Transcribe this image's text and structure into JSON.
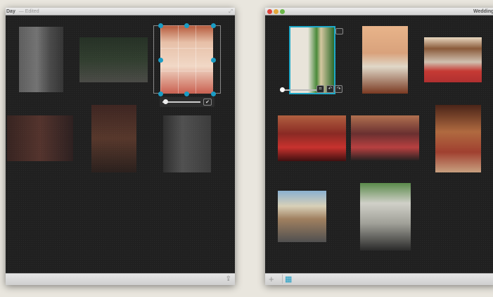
{
  "left_window": {
    "title": "Day",
    "edited": "— Edited",
    "photos": [
      "dress-hanging",
      "garden-path",
      "dress-back-crop",
      "reception-room",
      "church-interior",
      "couple-walking"
    ],
    "crop_grid_active": true
  },
  "right_window": {
    "title": "Wedding",
    "photos": [
      "marquee-rotated",
      "mirror-flowers",
      "tea-table",
      "guests-seated-1",
      "guests-seated-2",
      "church-aisle",
      "street-bus",
      "vintage-car"
    ]
  },
  "icons": {
    "share": "share-icon",
    "add": "plus-icon",
    "grid": "grid-icon",
    "expand": "fullscreen-icon",
    "check": "checkmark-icon",
    "crop": "crop-icon",
    "rotate_left": "rotate-left-icon",
    "rotate_right": "rotate-right-icon"
  },
  "accent": "#1a9cc4",
  "glyphs": {
    "check": "✔",
    "rotl": "↶",
    "rotr": "↷",
    "plus": "+",
    "expand": "⤢",
    "share": "⇪",
    "crop": "⌗",
    "grid": "▦"
  }
}
